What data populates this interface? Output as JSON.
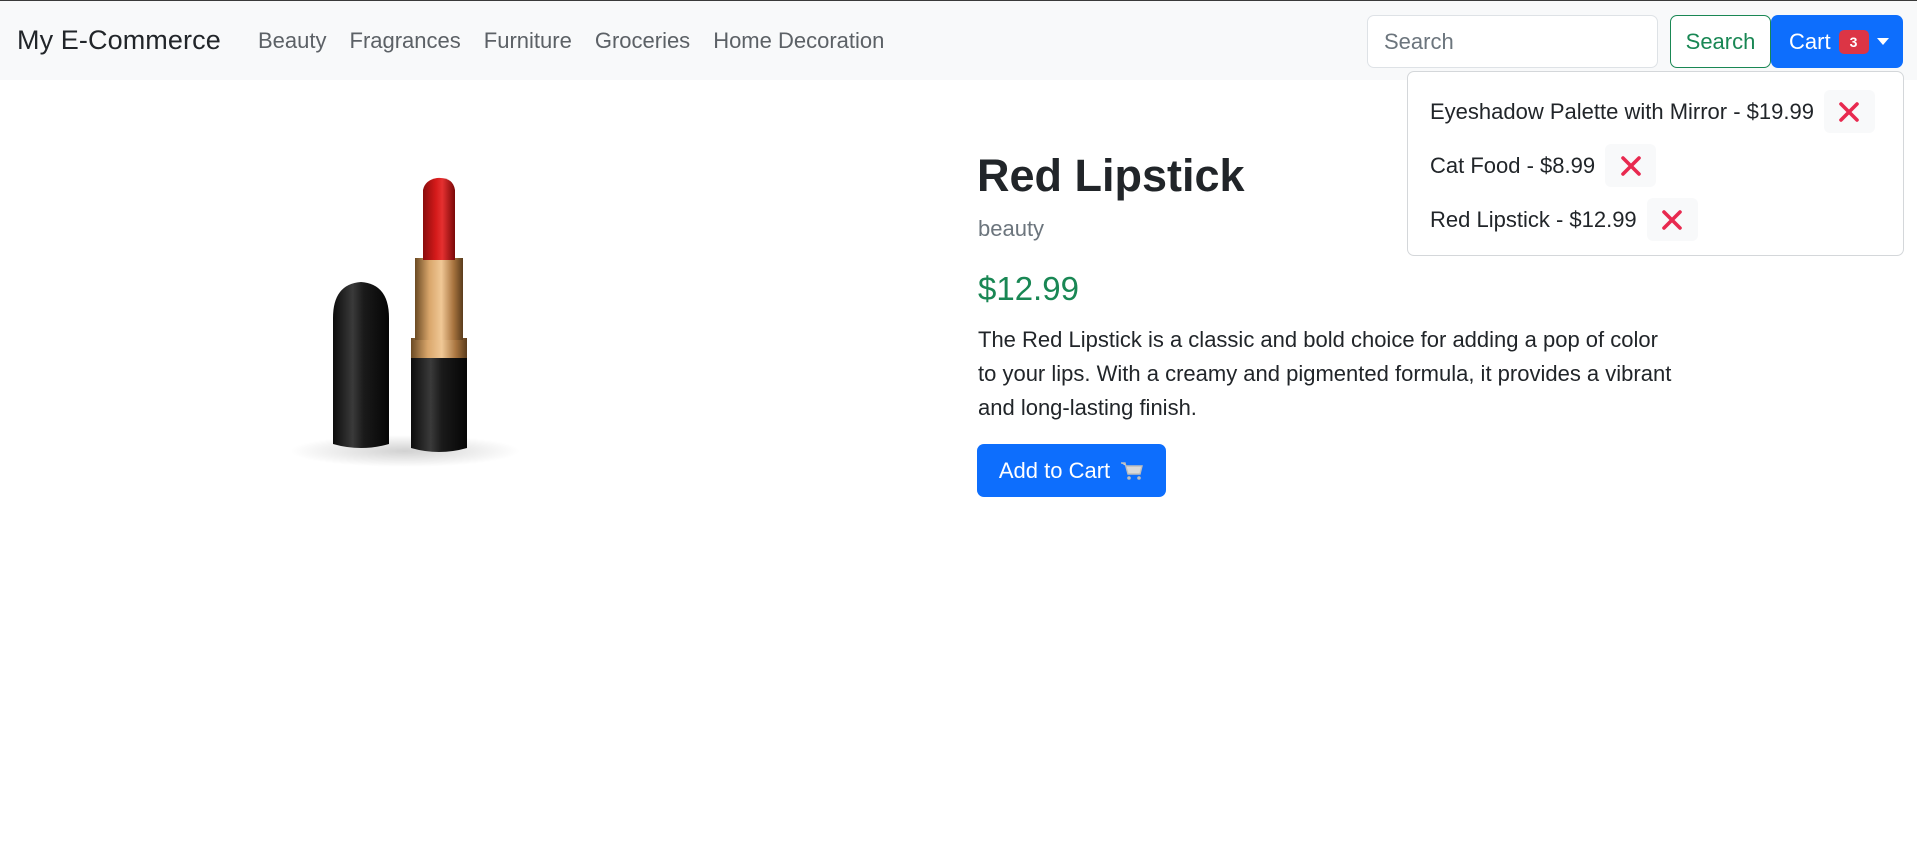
{
  "navbar": {
    "brand": "My E-Commerce",
    "links": [
      "Beauty",
      "Fragrances",
      "Furniture",
      "Groceries",
      "Home Decoration"
    ],
    "search_placeholder": "Search",
    "search_button": "Search",
    "cart_label": "Cart",
    "cart_count": "3"
  },
  "cart_dropdown": {
    "items": [
      "Eyeshadow Palette with Mirror - $19.99",
      "Cat Food - $8.99",
      "Red Lipstick - $12.99"
    ],
    "remove_icon": "x-icon"
  },
  "product": {
    "title": "Red Lipstick",
    "category": "beauty",
    "price": "$12.99",
    "description": "The Red Lipstick is a classic and bold choice for adding a pop of color to your lips. With a creamy and pigmented formula, it provides a vibrant and long-lasting finish.",
    "add_to_cart": "Add to Cart",
    "add_to_cart_icon": "shopping-cart-icon"
  },
  "colors": {
    "primary": "#0d6efd",
    "success": "#198754",
    "danger": "#dc3545",
    "remove_x": "#e8294f"
  }
}
